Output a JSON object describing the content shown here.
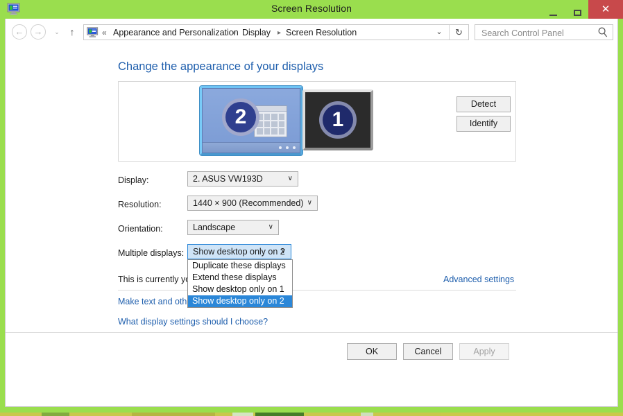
{
  "window": {
    "title": "Screen Resolution",
    "icon": "display-monitor-icon",
    "minimize_label": "–",
    "maximize_label": "□",
    "close_label": "✕"
  },
  "nav": {
    "back_glyph": "←",
    "forward_glyph": "→",
    "recent_glyph": "⌄",
    "up_glyph": "↑",
    "address_icon": "display-monitor-icon",
    "chevrons": "«",
    "breadcrumb": [
      "Appearance and Personalization",
      "Display",
      "Screen Resolution"
    ],
    "separator": "▸",
    "dropdown_glyph": "⌄",
    "refresh_glyph": "↻"
  },
  "search": {
    "placeholder": "Search Control Panel",
    "value": "",
    "icon": "search-icon"
  },
  "page": {
    "title": "Change the appearance of your displays"
  },
  "preview": {
    "monitor_selected": "2",
    "monitor_other": "1",
    "detect_label": "Detect",
    "identify_label": "Identify"
  },
  "form": {
    "display": {
      "label": "Display:",
      "value": "2. ASUS VW193D",
      "chevron": "∨"
    },
    "resolution": {
      "label": "Resolution:",
      "value": "1440 × 900 (Recommended)",
      "chevron": "∨"
    },
    "orientation": {
      "label": "Orientation:",
      "value": "Landscape",
      "chevron": "∨"
    },
    "multiple_displays": {
      "label": "Multiple displays:",
      "value": "Show desktop only on 2",
      "chevron": "∨",
      "expanded": true,
      "options": [
        "Duplicate these displays",
        "Extend these displays",
        "Show desktop only on 1",
        "Show desktop only on 2"
      ],
      "selected_index": 3
    }
  },
  "links": {
    "currently_text": "This is currently you",
    "advanced_settings": "Advanced settings",
    "make_text_larger": "Make text and other",
    "what_display_settings": "What display settings should I choose?"
  },
  "footer": {
    "ok_label": "OK",
    "cancel_label": "Cancel",
    "apply_label": "Apply",
    "apply_disabled": true
  },
  "colors": {
    "desktop_green": "#9ade4e",
    "accent_blue": "#1f5fad",
    "selection_blue": "#2b87d8",
    "close_red": "#c8494b"
  }
}
